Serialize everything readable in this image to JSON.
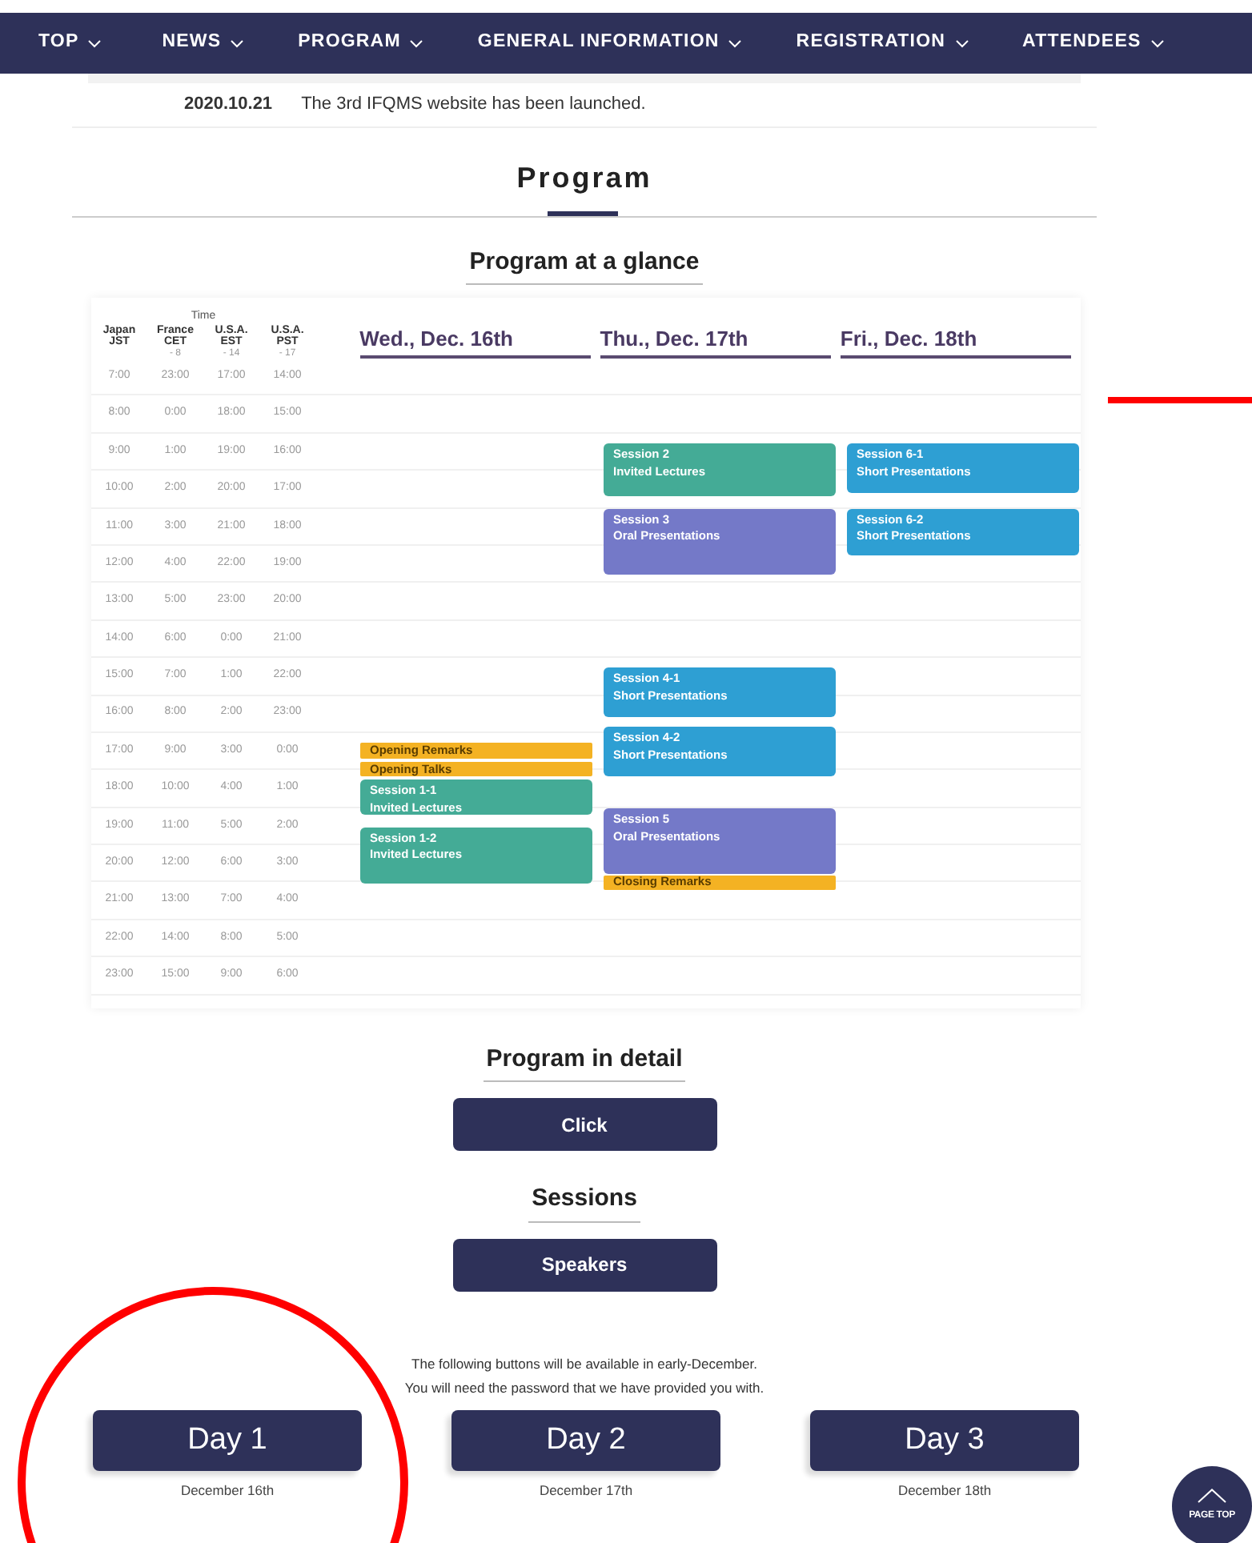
{
  "nav": [
    {
      "label": "TOP"
    },
    {
      "label": "NEWS"
    },
    {
      "label": "PROGRAM"
    },
    {
      "label": "GENERAL INFORMATION"
    },
    {
      "label": "REGISTRATION"
    },
    {
      "label": "ATTENDEES"
    }
  ],
  "news": [
    {
      "date": "2020.10.21",
      "text": "The 3rd IFQMS website has been launched."
    }
  ],
  "section_title": "Program",
  "glance": {
    "title": "Program at a glance",
    "time_header": "Time",
    "columns": [
      {
        "name": "Japan",
        "zone": "JST"
      },
      {
        "name": "France",
        "zone": "CET",
        "offset": "- 8"
      },
      {
        "name": "U.S.A.",
        "zone": "EST",
        "offset": "- 14"
      },
      {
        "name": "U.S.A.",
        "zone": "PST",
        "offset": "- 17"
      }
    ],
    "rows": [
      [
        "7:00",
        "23:00",
        "17:00",
        "14:00"
      ],
      [
        "8:00",
        "0:00",
        "18:00",
        "15:00"
      ],
      [
        "9:00",
        "1:00",
        "19:00",
        "16:00"
      ],
      [
        "10:00",
        "2:00",
        "20:00",
        "17:00"
      ],
      [
        "11:00",
        "3:00",
        "21:00",
        "18:00"
      ],
      [
        "12:00",
        "4:00",
        "22:00",
        "19:00"
      ],
      [
        "13:00",
        "5:00",
        "23:00",
        "20:00"
      ],
      [
        "14:00",
        "6:00",
        "0:00",
        "21:00"
      ],
      [
        "15:00",
        "7:00",
        "1:00",
        "22:00"
      ],
      [
        "16:00",
        "8:00",
        "2:00",
        "23:00"
      ],
      [
        "17:00",
        "9:00",
        "3:00",
        "0:00"
      ],
      [
        "18:00",
        "10:00",
        "4:00",
        "1:00"
      ],
      [
        "19:00",
        "11:00",
        "5:00",
        "2:00"
      ],
      [
        "20:00",
        "12:00",
        "6:00",
        "3:00"
      ],
      [
        "21:00",
        "13:00",
        "7:00",
        "4:00"
      ],
      [
        "22:00",
        "14:00",
        "8:00",
        "5:00"
      ],
      [
        "23:00",
        "15:00",
        "9:00",
        "6:00"
      ]
    ],
    "days": [
      {
        "label": "Wed., Dec. 16th",
        "events": [
          {
            "kind": "ceremony",
            "title": "Opening Remarks"
          },
          {
            "kind": "ceremony",
            "title": "Opening Talks"
          },
          {
            "kind": "invited",
            "title": "Session 1-1",
            "subtitle": "Invited Lectures"
          },
          {
            "kind": "invited",
            "title": "Session 1-2",
            "subtitle": "Invited Lectures"
          }
        ]
      },
      {
        "label": "Thu., Dec. 17th",
        "events": [
          {
            "kind": "invited",
            "title": "Session 2",
            "subtitle": "Invited Lectures"
          },
          {
            "kind": "oral",
            "title": "Session 3",
            "subtitle": "Oral Presentations"
          },
          {
            "kind": "short",
            "title": "Session 4-1",
            "subtitle": "Short Presentations"
          },
          {
            "kind": "short",
            "title": "Session 4-2",
            "subtitle": "Short Presentations"
          },
          {
            "kind": "oral",
            "title": "Session 5",
            "subtitle": "Oral Presentations"
          },
          {
            "kind": "ceremony",
            "title": "Closing Remarks"
          }
        ]
      },
      {
        "label": "Fri., Dec. 18th",
        "events": [
          {
            "kind": "short",
            "title": "Session 6-1",
            "subtitle": "Short Presentations"
          },
          {
            "kind": "short",
            "title": "Session 6-2",
            "subtitle": "Short Presentations"
          }
        ]
      }
    ]
  },
  "detail": {
    "title": "Program in detail",
    "button": "Click"
  },
  "sessions": {
    "title": "Sessions",
    "button": "Speakers"
  },
  "notice": [
    "The following buttons will be available in early-December.",
    "You will need the password that we have provided you with."
  ],
  "day_buttons": [
    {
      "label": "Day 1",
      "date": "December 16th"
    },
    {
      "label": "Day 2",
      "date": "December 17th"
    },
    {
      "label": "Day 3",
      "date": "December 18th"
    }
  ],
  "page_top": {
    "label": "PAGE TOP"
  },
  "annotations": [
    {
      "kind": "circle"
    },
    {
      "kind": "line"
    }
  ]
}
